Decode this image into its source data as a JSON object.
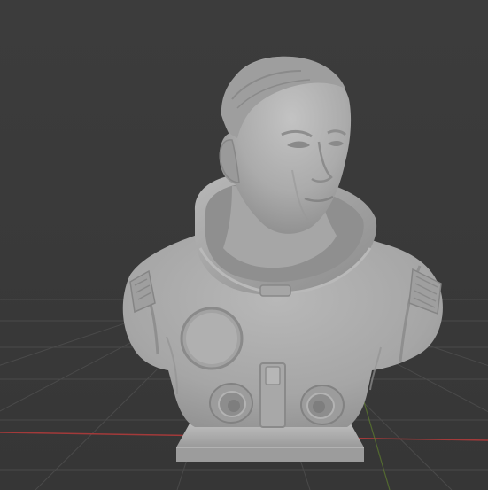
{
  "viewport": {
    "background_color": "#3a3a3a",
    "grid_color": "#4a4a4a",
    "x_axis_color": "#a33a3a",
    "y_axis_color": "#5f7f2e",
    "grid_visible": true
  },
  "model": {
    "subject": "astronaut-bust",
    "material_color": "#a9a9a9",
    "base_color": "#b2b2b2"
  }
}
